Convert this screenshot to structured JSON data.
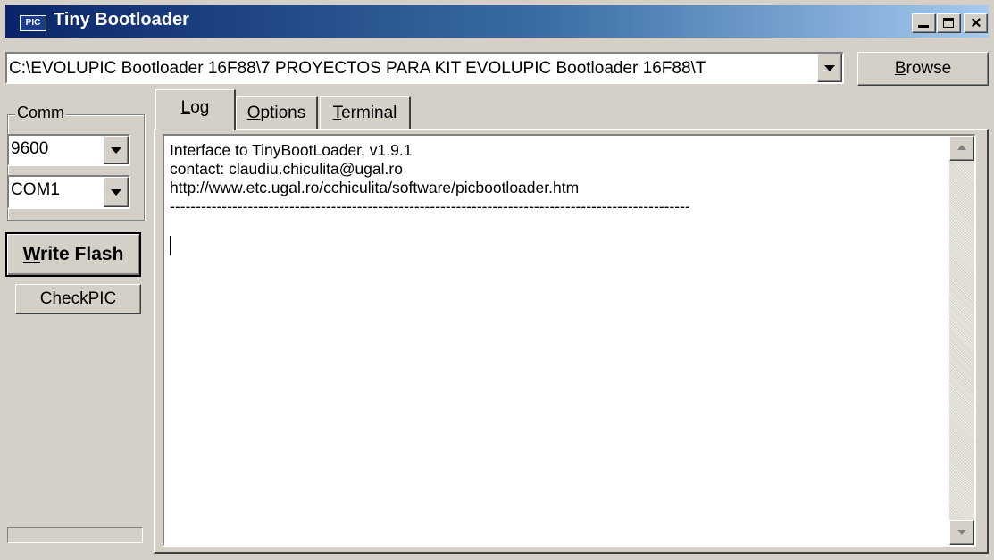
{
  "window": {
    "title": "Tiny Bootloader",
    "icon_text": "PIC",
    "controls": {
      "minimize": "minimize-icon",
      "maximize": "maximize-icon",
      "close": "×"
    }
  },
  "path": {
    "value": "C:\\EVOLUPIC Bootloader 16F88\\7 PROYECTOS PARA KIT EVOLUPIC Bootloader 16F88\\T",
    "browse_label_mnemonic": "B",
    "browse_label_rest": "rowse"
  },
  "comm": {
    "group_label": "Comm",
    "baud_value": "9600",
    "port_value": "COM1"
  },
  "actions": {
    "write_flash_mnemonic": "W",
    "write_flash_rest": "rite Flash",
    "checkpic_label": "CheckPIC"
  },
  "tabs": [
    {
      "mnemonic": "L",
      "rest": "og",
      "active": true
    },
    {
      "mnemonic": "O",
      "rest": "ptions",
      "active": false
    },
    {
      "mnemonic": "T",
      "rest": "erminal",
      "active": false
    }
  ],
  "log": {
    "lines": [
      "Interface to TinyBootLoader, v1.9.1",
      "contact: claudiu.chiculita@ugal.ro",
      "http://www.etc.ugal.ro/cchiculita/software/picbootloader.htm",
      "----------------------------------------------------------------------------------------------------"
    ]
  }
}
